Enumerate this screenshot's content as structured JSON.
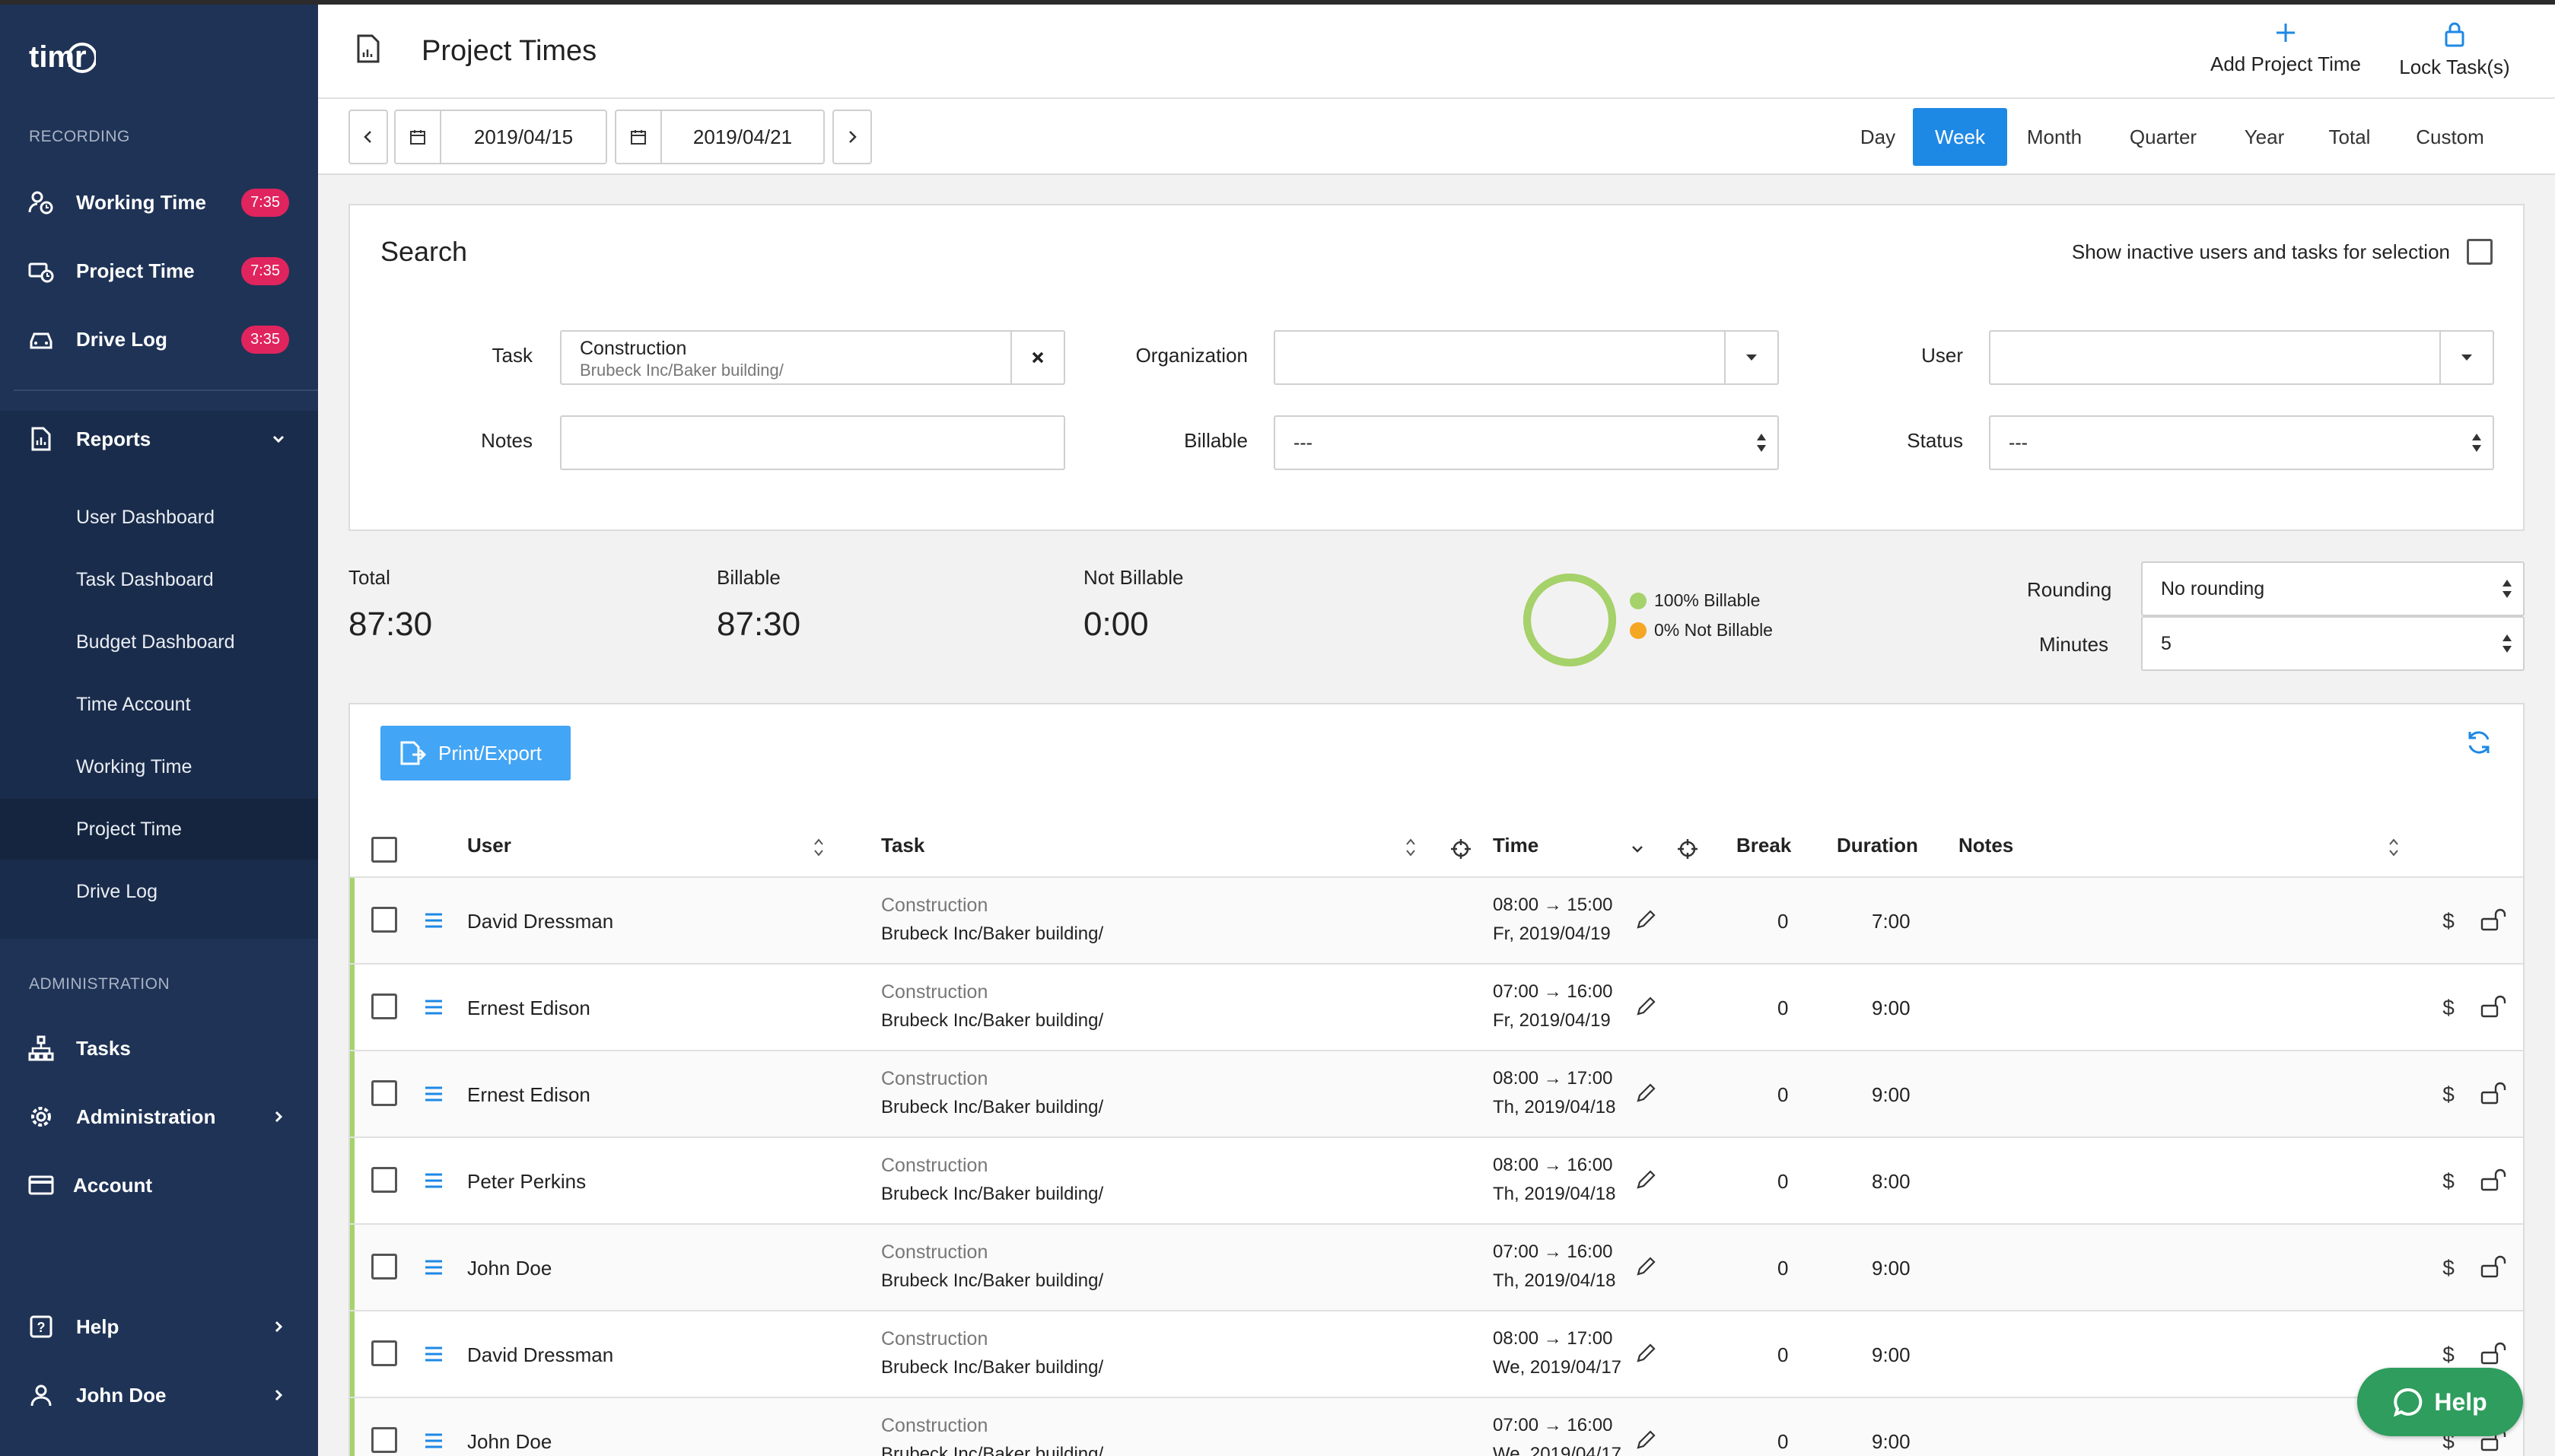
{
  "app": {
    "logo_text": "timr"
  },
  "sidebar": {
    "recording_label": "RECORDING",
    "recording": [
      {
        "label": "Working Time",
        "badge": "7:35"
      },
      {
        "label": "Project Time",
        "badge": "7:35"
      },
      {
        "label": "Drive Log",
        "badge": "3:35"
      }
    ],
    "reports_label": "Reports",
    "reports_sub": [
      {
        "label": "User Dashboard"
      },
      {
        "label": "Task Dashboard"
      },
      {
        "label": "Budget Dashboard"
      },
      {
        "label": "Time Account"
      },
      {
        "label": "Working Time"
      },
      {
        "label": "Project Time"
      },
      {
        "label": "Drive Log"
      }
    ],
    "admin_label": "ADMINISTRATION",
    "admin": [
      {
        "label": "Tasks"
      },
      {
        "label": "Administration"
      },
      {
        "label": "Account"
      }
    ],
    "bottom": [
      {
        "label": "Help"
      },
      {
        "label": "John Doe"
      }
    ]
  },
  "header": {
    "title": "Project Times",
    "add_label": "Add Project Time",
    "lock_label": "Lock Task(s)"
  },
  "datebar": {
    "from": "2019/04/15",
    "to": "2019/04/21",
    "periods": [
      "Day",
      "Week",
      "Month",
      "Quarter",
      "Year",
      "Total",
      "Custom"
    ],
    "active_period": "Week"
  },
  "search": {
    "title": "Search",
    "inactive_label": "Show inactive users and tasks for selection",
    "task_label": "Task",
    "task_value": "Construction",
    "task_path": "Brubeck Inc/Baker building/",
    "org_label": "Organization",
    "user_label": "User",
    "notes_label": "Notes",
    "billable_label": "Billable",
    "billable_value": "---",
    "status_label": "Status",
    "status_value": "---"
  },
  "summary": {
    "total_label": "Total",
    "total": "87:30",
    "billable_label": "Billable",
    "billable": "87:30",
    "not_billable_label": "Not Billable",
    "not_billable": "0:00",
    "legend_billable": "100% Billable",
    "legend_not_billable": "0% Not Billable",
    "billable_fraction": 1.0,
    "rounding_label": "Rounding",
    "rounding_value": "No rounding",
    "minutes_label": "Minutes",
    "minutes_value": "5"
  },
  "colors": {
    "sidebar": "#1f3356",
    "accent": "#1e88e5",
    "badge": "#e0245e",
    "billable": "#a5d26b",
    "not_billable": "#f5a623",
    "help": "#2e9d5d"
  },
  "table": {
    "export_label": "Print/Export",
    "headers": {
      "user": "User",
      "task": "Task",
      "time": "Time",
      "break": "Break",
      "duration": "Duration",
      "notes": "Notes"
    },
    "rows": [
      {
        "user": "David Dressman",
        "task": "Construction",
        "path": "Brubeck Inc/Baker building/",
        "time": "08:00 → 15:00",
        "date": "Fr, 2019/04/19",
        "break": "0",
        "duration": "7:00"
      },
      {
        "user": "Ernest Edison",
        "task": "Construction",
        "path": "Brubeck Inc/Baker building/",
        "time": "07:00 → 16:00",
        "date": "Fr, 2019/04/19",
        "break": "0",
        "duration": "9:00"
      },
      {
        "user": "Ernest Edison",
        "task": "Construction",
        "path": "Brubeck Inc/Baker building/",
        "time": "08:00 → 17:00",
        "date": "Th, 2019/04/18",
        "break": "0",
        "duration": "9:00"
      },
      {
        "user": "Peter Perkins",
        "task": "Construction",
        "path": "Brubeck Inc/Baker building/",
        "time": "08:00 → 16:00",
        "date": "Th, 2019/04/18",
        "break": "0",
        "duration": "8:00"
      },
      {
        "user": "John Doe",
        "task": "Construction",
        "path": "Brubeck Inc/Baker building/",
        "time": "07:00 → 16:00",
        "date": "Th, 2019/04/18",
        "break": "0",
        "duration": "9:00"
      },
      {
        "user": "David Dressman",
        "task": "Construction",
        "path": "Brubeck Inc/Baker building/",
        "time": "08:00 → 17:00",
        "date": "We, 2019/04/17",
        "break": "0",
        "duration": "9:00"
      },
      {
        "user": "John Doe",
        "task": "Construction",
        "path": "Brubeck Inc/Baker building/",
        "time": "07:00 → 16:00",
        "date": "We, 2019/04/17",
        "break": "0",
        "duration": "9:00"
      }
    ]
  },
  "help_button": {
    "label": "Help"
  }
}
